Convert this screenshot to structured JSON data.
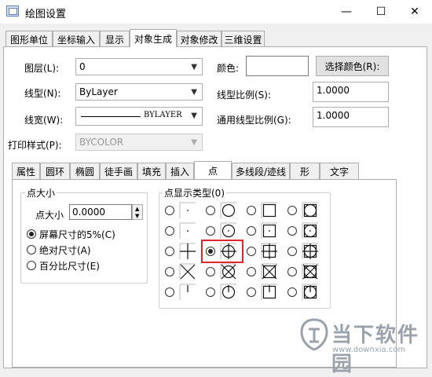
{
  "window": {
    "title": "绘图设置",
    "minimize_glyph": "—",
    "maximize_glyph": "☐",
    "close_glyph": "✕"
  },
  "main_tabs": [
    {
      "label": "图形单位",
      "active": false
    },
    {
      "label": "坐标输入",
      "active": false
    },
    {
      "label": "显示",
      "active": false
    },
    {
      "label": "对象生成",
      "active": true
    },
    {
      "label": "对象修改",
      "active": false
    },
    {
      "label": "三维设置",
      "active": false
    }
  ],
  "object_gen": {
    "layer": {
      "label": "图层(L):",
      "value": "0"
    },
    "linetype": {
      "label": "线型(N):",
      "value": "ByLayer"
    },
    "lineweight": {
      "label": "线宽(W):",
      "value": "BYLAYER"
    },
    "plotstyle": {
      "label": "打印样式(P):",
      "value": "BYCOLOR"
    },
    "color": {
      "label": "颜色:",
      "value": ""
    },
    "select_color_button": "选择颜色(R):",
    "linetype_scale": {
      "label": "线型比例(S):",
      "value": "1.0000"
    },
    "global_linetype_scale": {
      "label": "通用线型比例(G):",
      "value": "1.0000"
    }
  },
  "sub_tabs": [
    {
      "label": "属性",
      "active": false
    },
    {
      "label": "圆环",
      "active": false
    },
    {
      "label": "椭圆",
      "active": false
    },
    {
      "label": "徒手画",
      "active": false
    },
    {
      "label": "填充",
      "active": false
    },
    {
      "label": "插入",
      "active": false
    },
    {
      "label": "点",
      "active": true
    },
    {
      "label": "多线段/迹线",
      "active": false
    },
    {
      "label": "形",
      "active": false
    },
    {
      "label": "文字",
      "active": false
    }
  ],
  "point_panel": {
    "size_group_title": "点大小",
    "size_label": "点大小",
    "size_value": "0.0000",
    "size_modes": [
      {
        "label": "屏幕尺寸的5%(C)",
        "checked": true
      },
      {
        "label": "绝对尺寸(A)",
        "checked": false
      },
      {
        "label": "百分比尺寸(E)",
        "checked": false
      }
    ],
    "display_type_title": "点显示类型(0)",
    "selected_index": 9,
    "styles": [
      "dot",
      "none",
      "circle",
      "square",
      "circle-square",
      "dot-small",
      "circle-dot",
      "square-dot",
      "circle-square-dot",
      "plus",
      "circle-plus",
      "square-plus",
      "circle-square-plus",
      "x",
      "circle-x",
      "square-x",
      "circle-square-x",
      "tick",
      "circle-tick",
      "square-tick",
      "circle-square-tick"
    ]
  },
  "watermark": {
    "brand": "当下软件园",
    "url": "www.downxia.com"
  }
}
